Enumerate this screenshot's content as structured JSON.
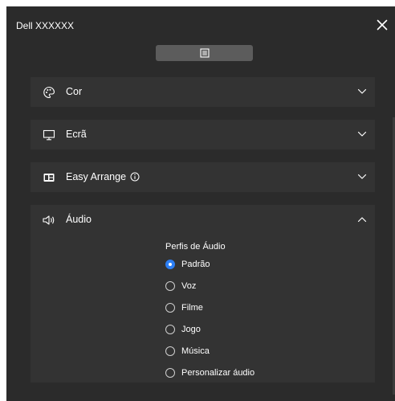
{
  "window": {
    "title": "Dell XXXXXX"
  },
  "toolbar": {
    "menu_icon": "list-menu-icon"
  },
  "panels": [
    {
      "label": "Cor",
      "icon": "palette-icon",
      "expanded": false
    },
    {
      "label": "Ecrã",
      "icon": "monitor-icon",
      "expanded": false
    },
    {
      "label": "Easy Arrange",
      "icon": "layout-icon",
      "info_icon": "info-icon",
      "expanded": false
    },
    {
      "label": "Áudio",
      "icon": "speaker-icon",
      "expanded": true
    }
  ],
  "audio": {
    "section_label": "Perfis de Áudio",
    "profiles": [
      {
        "label": "Padrão",
        "selected": true
      },
      {
        "label": "Voz",
        "selected": false
      },
      {
        "label": "Filme",
        "selected": false
      },
      {
        "label": "Jogo",
        "selected": false
      },
      {
        "label": "Música",
        "selected": false
      },
      {
        "label": "Personalizar áudio",
        "selected": false
      }
    ]
  },
  "colors": {
    "background": "#2b2b2b",
    "panel": "#333333",
    "accent": "#2d7ff4"
  }
}
